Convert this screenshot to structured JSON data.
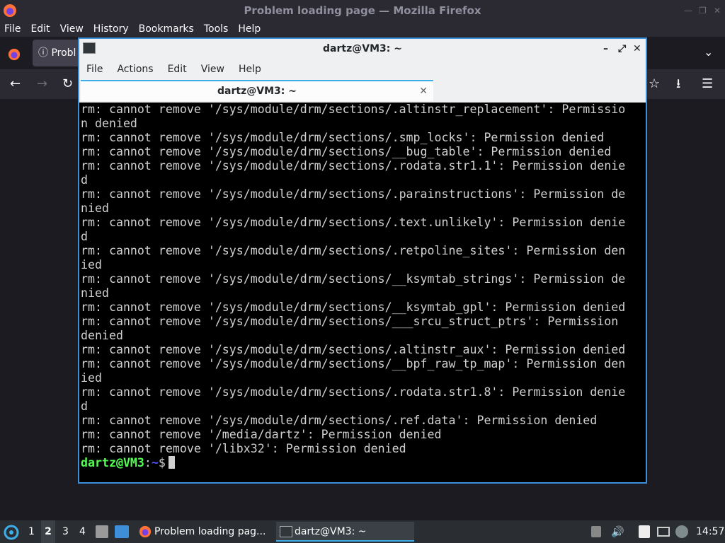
{
  "firefox": {
    "title": "Problem loading page — Mozilla Firefox",
    "menu": [
      "File",
      "Edit",
      "View",
      "History",
      "Bookmarks",
      "Tools",
      "Help"
    ],
    "tab_label": "Probl",
    "min_icon": "minimize-icon",
    "max_icon": "maximize-icon",
    "close_icon": "close-icon"
  },
  "terminal": {
    "title": "dartz@VM3: ~",
    "menu": [
      "File",
      "Actions",
      "Edit",
      "View",
      "Help"
    ],
    "tab_label": "dartz@VM3: ~",
    "lines": [
      "rm: cannot remove '/sys/module/drm/sections/.altinstr_replacement': Permissio",
      "n denied",
      "rm: cannot remove '/sys/module/drm/sections/.smp_locks': Permission denied",
      "rm: cannot remove '/sys/module/drm/sections/__bug_table': Permission denied",
      "rm: cannot remove '/sys/module/drm/sections/.rodata.str1.1': Permission denie",
      "d",
      "rm: cannot remove '/sys/module/drm/sections/.parainstructions': Permission de",
      "nied",
      "rm: cannot remove '/sys/module/drm/sections/.text.unlikely': Permission denie",
      "d",
      "rm: cannot remove '/sys/module/drm/sections/.retpoline_sites': Permission den",
      "ied",
      "rm: cannot remove '/sys/module/drm/sections/__ksymtab_strings': Permission de",
      "nied",
      "rm: cannot remove '/sys/module/drm/sections/__ksymtab_gpl': Permission denied",
      "rm: cannot remove '/sys/module/drm/sections/___srcu_struct_ptrs': Permission",
      "denied",
      "rm: cannot remove '/sys/module/drm/sections/.altinstr_aux': Permission denied",
      "rm: cannot remove '/sys/module/drm/sections/__bpf_raw_tp_map': Permission den",
      "ied",
      "rm: cannot remove '/sys/module/drm/sections/.rodata.str1.8': Permission denie",
      "d",
      "rm: cannot remove '/sys/module/drm/sections/.ref.data': Permission denied",
      "rm: cannot remove '/media/dartz': Permission denied",
      "rm: cannot remove '/libx32': Permission denied"
    ],
    "prompt_user": "dartz@VM3",
    "prompt_sep": ":",
    "prompt_path": "~",
    "prompt_end": "$"
  },
  "taskbar": {
    "workspaces": [
      "1",
      "2",
      "3",
      "4"
    ],
    "active_workspace": "2",
    "windows": [
      {
        "label": "Problem loading pag...",
        "icon": "firefox-icon"
      },
      {
        "label": "dartz@VM3: ~",
        "icon": "terminal-icon"
      }
    ],
    "clock": "14:57"
  }
}
